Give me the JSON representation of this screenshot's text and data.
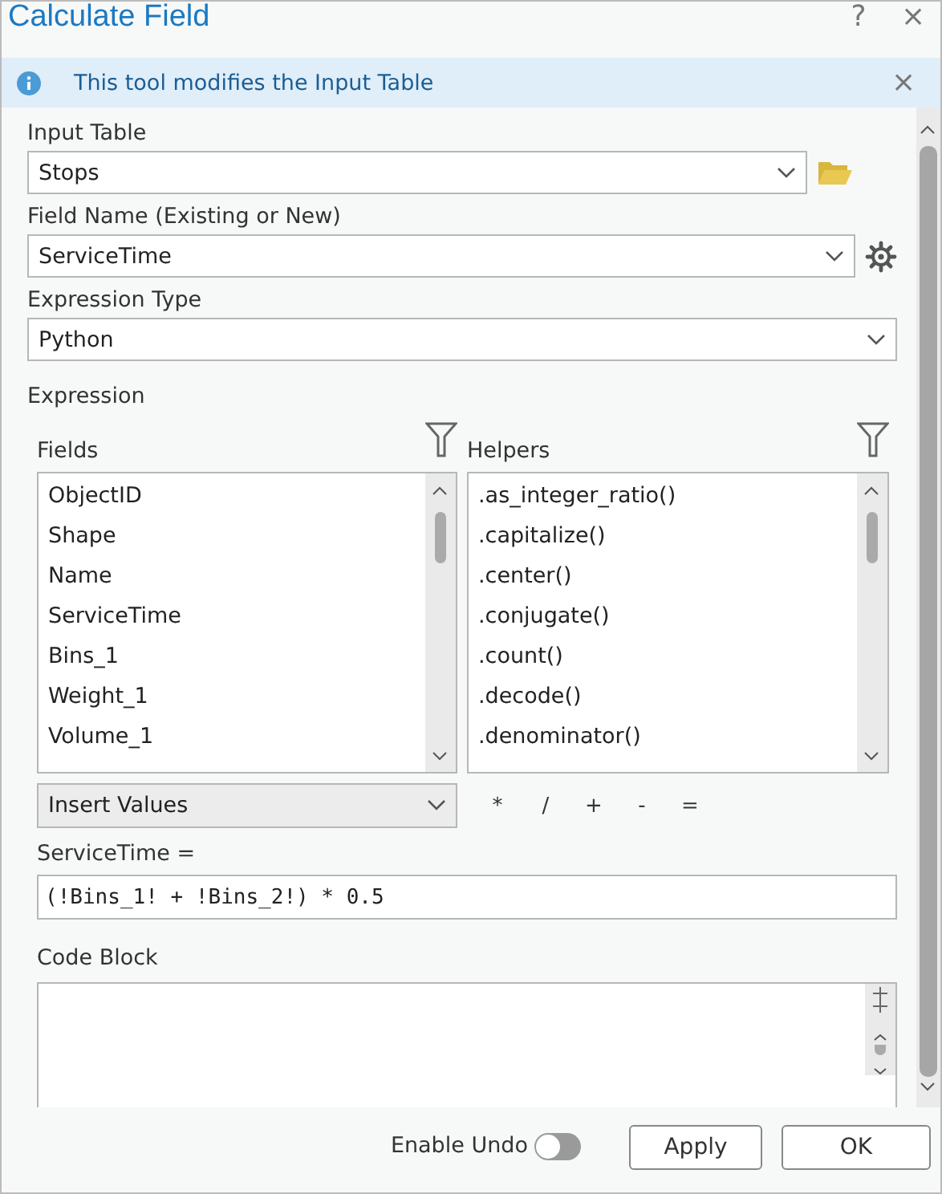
{
  "window": {
    "title": "Calculate Field",
    "help": "?",
    "close": "×"
  },
  "banner": {
    "text": "This tool modifies the Input Table",
    "close": "×"
  },
  "input_table": {
    "label": "Input Table",
    "value": "Stops"
  },
  "field_name": {
    "label": "Field Name (Existing or New)",
    "value": "ServiceTime"
  },
  "expression_type": {
    "label": "Expression Type",
    "value": "Python"
  },
  "expression": {
    "label": "Expression",
    "fields": {
      "label": "Fields",
      "items": [
        "ObjectID",
        "Shape",
        "Name",
        "ServiceTime",
        "Bins_1",
        "Weight_1",
        "Volume_1"
      ]
    },
    "helpers": {
      "label": "Helpers",
      "items": [
        ".as_integer_ratio()",
        ".capitalize()",
        ".center()",
        ".conjugate()",
        ".count()",
        ".decode()",
        ".denominator()"
      ]
    },
    "insert": {
      "value": "Insert Values"
    },
    "operators": [
      "*",
      "/",
      "+",
      "-",
      "="
    ],
    "target_label": "ServiceTime =",
    "value": "(!Bins_1! + !Bins_2!) * 0.5"
  },
  "code_block": {
    "label": "Code Block"
  },
  "footer": {
    "undo": {
      "label": "Enable Undo",
      "on": false
    },
    "buttons": [
      "Apply",
      "OK"
    ]
  }
}
